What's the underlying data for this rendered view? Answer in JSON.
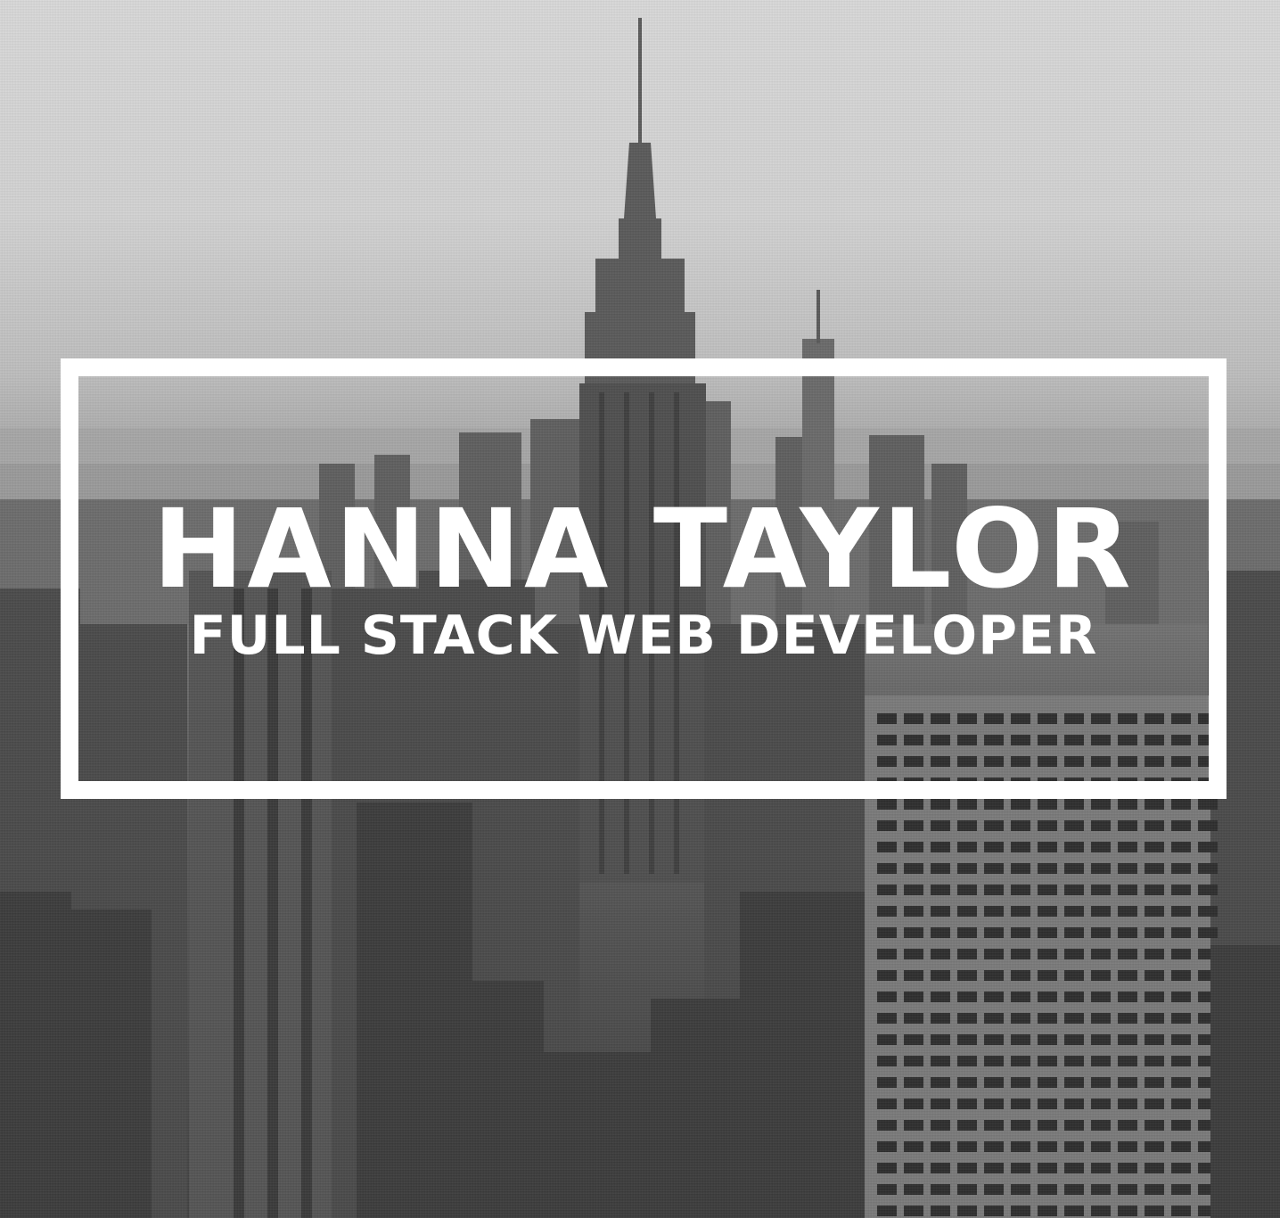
{
  "hero": {
    "name": "HANNA TAYLOR",
    "role": "FULL STACK WEB DEVELOPER",
    "background_image": "black-and-white-manhattan-skyline",
    "colors": {
      "text": "#ffffff",
      "frame": "#ffffff"
    }
  }
}
